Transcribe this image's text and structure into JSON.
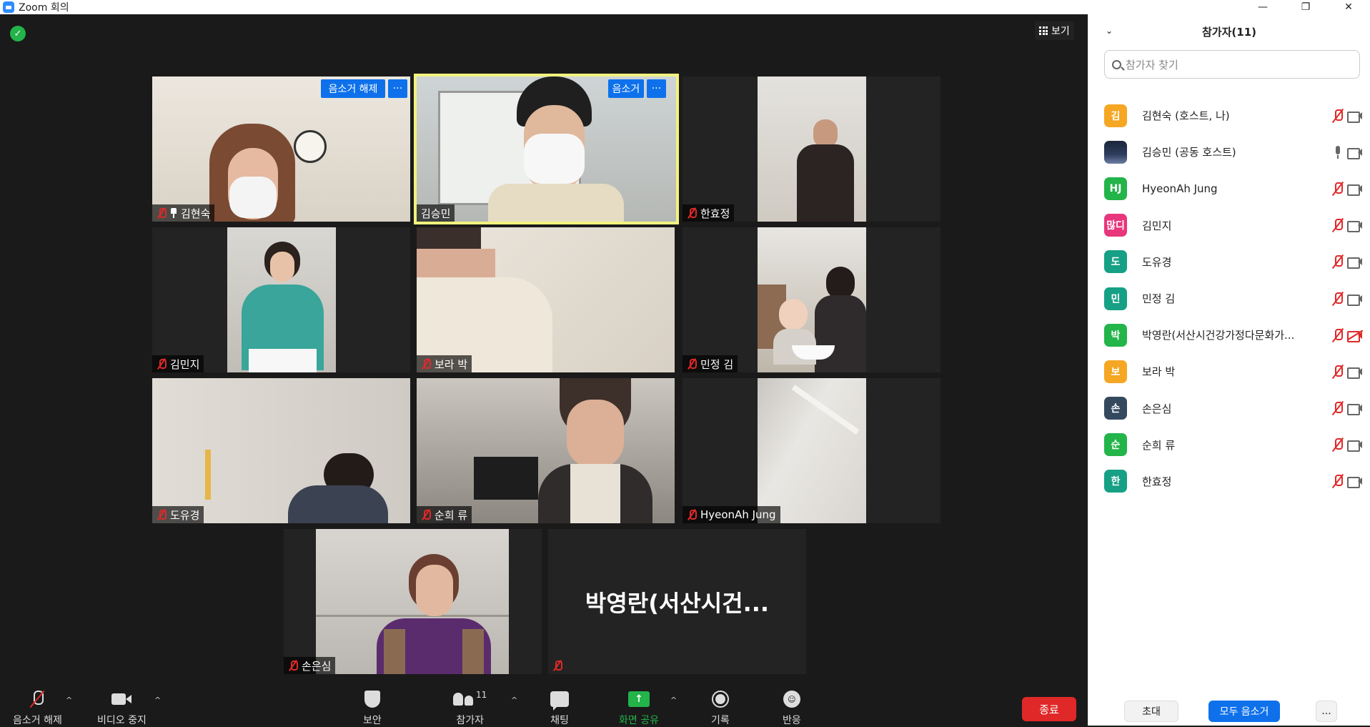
{
  "window": {
    "title": "Zoom 회의",
    "controls": [
      "—",
      "❐",
      "✕"
    ]
  },
  "meeting": {
    "view_label": "보기",
    "tiles": [
      {
        "name": "김현숙",
        "muted": true,
        "pinned": true,
        "buttons": [
          "음소거 해제",
          "···"
        ]
      },
      {
        "name": "김승민",
        "muted": false,
        "active": true,
        "buttons": [
          "음소거",
          "···"
        ]
      },
      {
        "name": "한효정",
        "muted": true
      },
      {
        "name": "김민지",
        "muted": true
      },
      {
        "name": "보라 박",
        "muted": true
      },
      {
        "name": "민정 김",
        "muted": true
      },
      {
        "name": "도유경",
        "muted": true
      },
      {
        "name": "순희 류",
        "muted": true
      },
      {
        "name": "HyeonAh Jung",
        "muted": true
      },
      {
        "name": "손은심",
        "muted": true
      },
      {
        "name": "",
        "display_name": "박영란(서산시건...",
        "muted": true,
        "video_off": true
      }
    ]
  },
  "toolbar": {
    "unmute": "음소거 해제",
    "stop_video": "비디오 중지",
    "security": "보안",
    "participants": "참가자",
    "participants_count": "11",
    "chat": "채팅",
    "share": "화면 공유",
    "record": "기록",
    "reactions": "반응",
    "end": "종료",
    "caret": "^"
  },
  "panel": {
    "title": "참가자(11)",
    "search_placeholder": "참가자 찾기",
    "participants": [
      {
        "avatar": "김",
        "color": "#f5a623",
        "name": "김현숙 (호스트, 나)",
        "mic": "off",
        "cam": "on"
      },
      {
        "avatar": "",
        "color": "photo",
        "name": "김승민 (공동 호스트)",
        "mic": "on",
        "cam": "on"
      },
      {
        "avatar": "HJ",
        "color": "#23b44a",
        "name": "HyeonAh Jung",
        "mic": "off",
        "cam": "on"
      },
      {
        "avatar": "많디",
        "color": "#e8367c",
        "name": "김민지",
        "mic": "off",
        "cam": "on"
      },
      {
        "avatar": "도",
        "color": "#16a085",
        "name": "도유경",
        "mic": "off",
        "cam": "on"
      },
      {
        "avatar": "민",
        "color": "#16a085",
        "name": "민정 김",
        "mic": "off",
        "cam": "on"
      },
      {
        "avatar": "박",
        "color": "#23b44a",
        "name": "박영란(서산시건강가정다문화가...",
        "mic": "off",
        "cam": "off"
      },
      {
        "avatar": "보",
        "color": "#f5a623",
        "name": "보라 박",
        "mic": "off",
        "cam": "on"
      },
      {
        "avatar": "손",
        "color": "#34495e",
        "name": "손은심",
        "mic": "off",
        "cam": "on"
      },
      {
        "avatar": "순",
        "color": "#23b44a",
        "name": "순희 류",
        "mic": "off",
        "cam": "on"
      },
      {
        "avatar": "한",
        "color": "#16a085",
        "name": "한효정",
        "mic": "off",
        "cam": "on"
      }
    ],
    "invite": "초대",
    "mute_all": "모두 음소거",
    "more": "..."
  }
}
